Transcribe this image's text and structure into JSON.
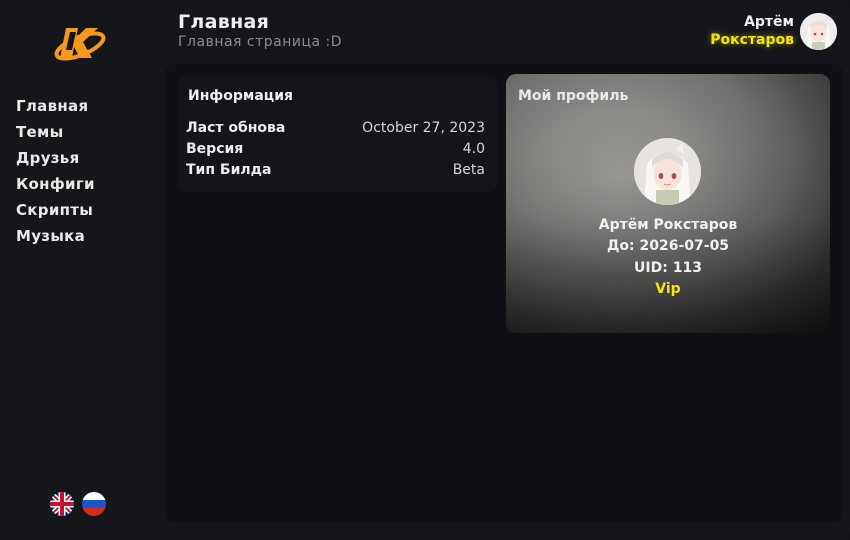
{
  "header": {
    "title": "Главная",
    "subtitle": "Главная страница :D"
  },
  "user": {
    "first_name": "Артём",
    "last_name": "Рокстаров",
    "accent_color": "#f3e511"
  },
  "sidebar": {
    "items": [
      {
        "label": "Главная"
      },
      {
        "label": "Темы"
      },
      {
        "label": "Друзья"
      },
      {
        "label": "Конфиги"
      },
      {
        "label": "Скрипты"
      },
      {
        "label": "Музыка"
      }
    ],
    "languages": [
      "uk-flag-icon",
      "russia-flag-icon"
    ]
  },
  "info": {
    "title": "Информация",
    "rows": [
      {
        "key": "Ласт обнова",
        "value": "October 27, 2023"
      },
      {
        "key": "Версия",
        "value": "4.0"
      },
      {
        "key": "Тип Билда",
        "value": "Beta"
      }
    ]
  },
  "profile": {
    "label": "Мой профиль",
    "name": "Артём Рокстаров",
    "until": "До: 2026-07-05",
    "uid": "UID: 113",
    "status": "Vip"
  },
  "colors": {
    "accent": "#f3e511",
    "logo": "#f39a1e",
    "background": "#15161b",
    "panel": "#0f1014"
  }
}
